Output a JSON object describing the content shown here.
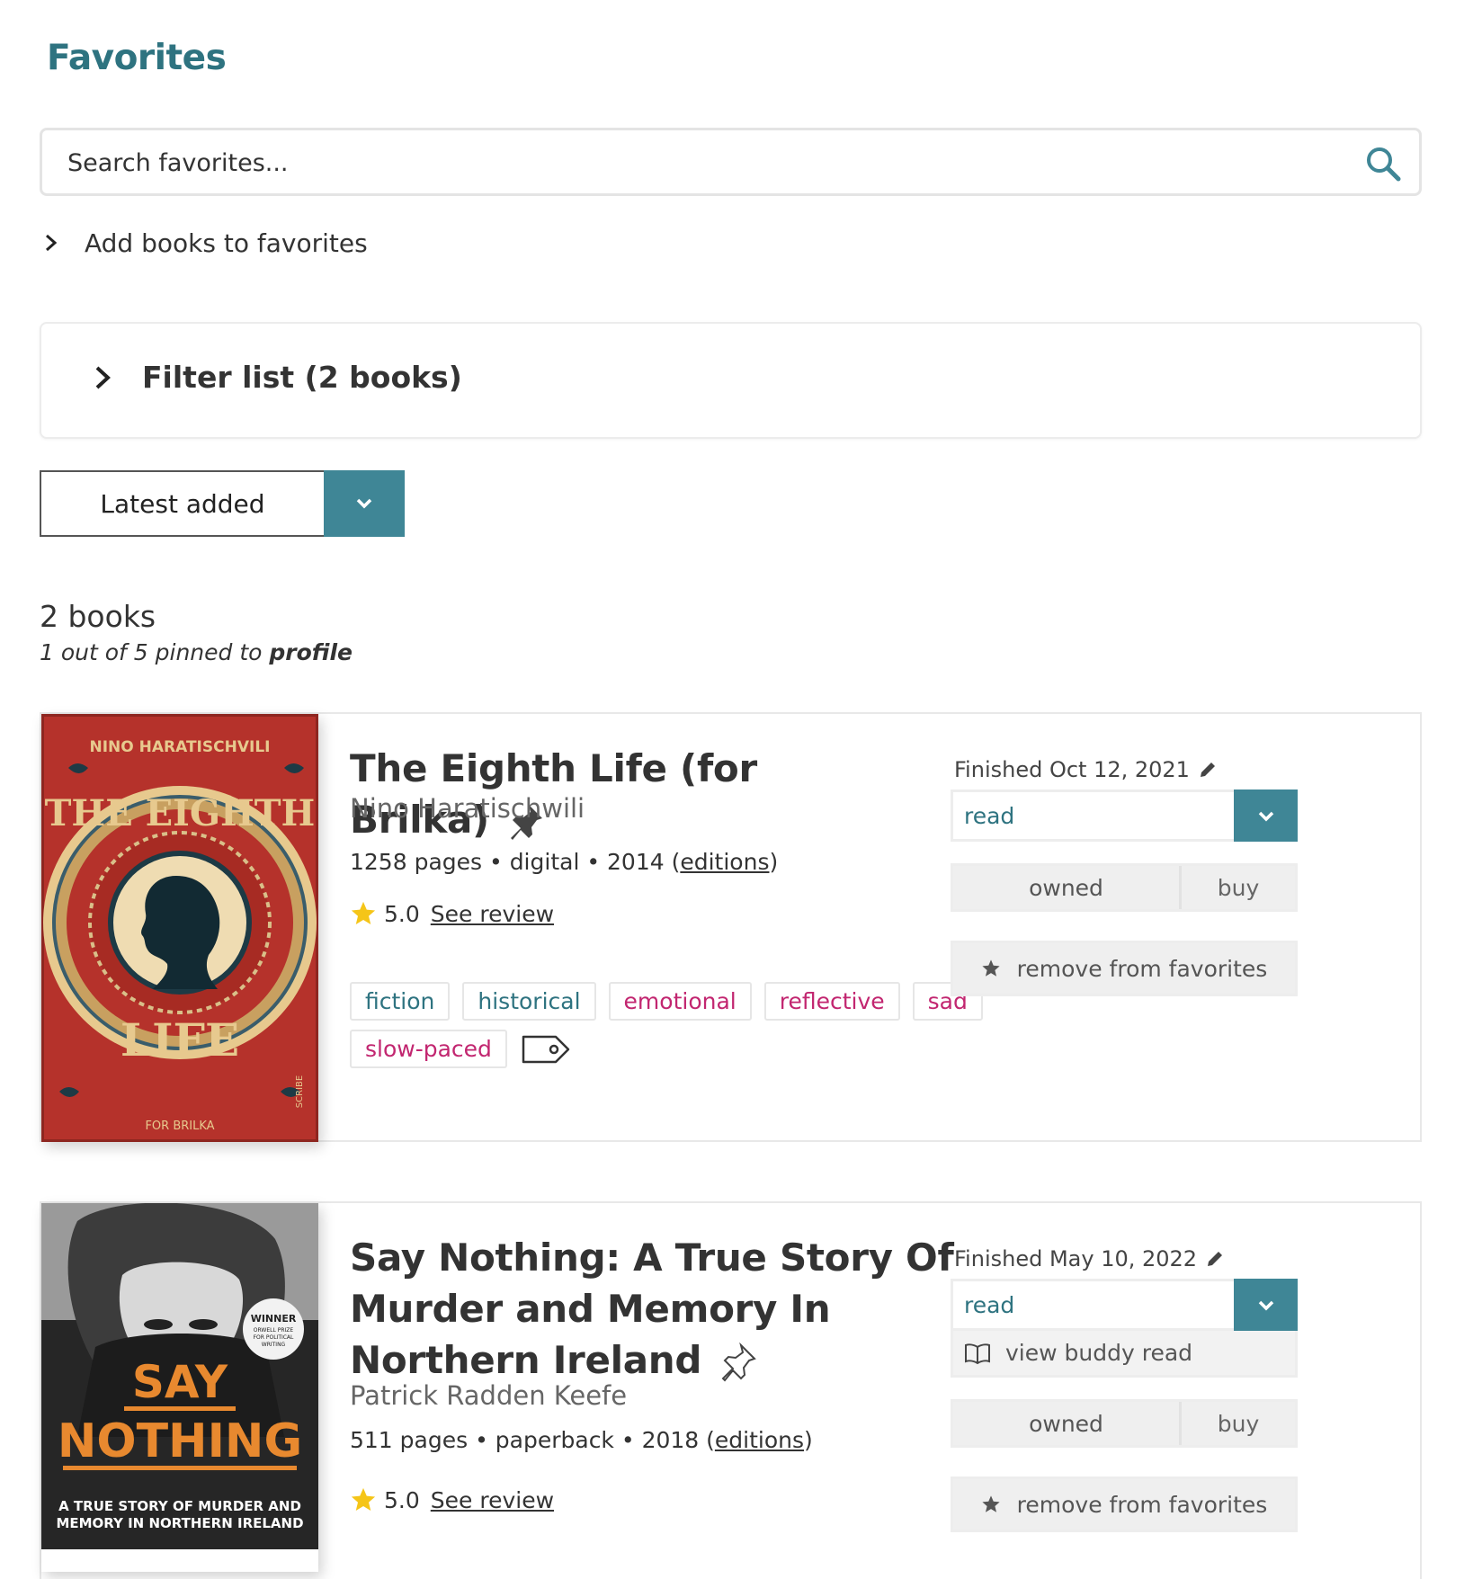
{
  "page": {
    "title": "Favorites",
    "search_placeholder": "Search favorites...",
    "add_books_label": "Add books to favorites",
    "filter_label": "Filter list (2 books)",
    "sort_value": "Latest added",
    "count_label": "2 books",
    "pinned_prefix": "1 out of 5 pinned to",
    "pinned_link": "profile"
  },
  "colors": {
    "accent": "#3f8696",
    "title_teal": "#2e7380",
    "mood_tag": "#c22670",
    "star_yellow": "#f5c518"
  },
  "books": [
    {
      "title": "The Eighth Life (for Brilka)",
      "pinned": true,
      "author": "Nino Haratischwili",
      "pages": "1258 pages",
      "format": "digital",
      "year": "2014",
      "editions_label": "editions",
      "rating": "5.0",
      "review_label": "See review",
      "tags_genre": [
        "fiction",
        "historical"
      ],
      "tags_mood": [
        "emotional",
        "reflective",
        "sad",
        "slow-paced"
      ],
      "finished": "Finished Oct 12, 2021",
      "status": "read",
      "owned_label": "owned",
      "buy_label": "buy",
      "remove_label": "remove from favorites",
      "cover": {
        "author_text": "NINO HARATISCHVILI",
        "title_top": "THE EIGHTH",
        "title_bottom": "LIFE",
        "subtitle": "FOR BRILKA",
        "publisher": "SCRIBE"
      }
    },
    {
      "title": "Say Nothing: A True Story Of Murder and Memory In Northern Ireland",
      "pinned": false,
      "author": "Patrick Radden Keefe",
      "pages": "511 pages",
      "format": "paperback",
      "year": "2018",
      "editions_label": "editions",
      "rating": "5.0",
      "review_label": "See review",
      "finished": "Finished May 10, 2022",
      "status": "read",
      "buddy_label": "view buddy read",
      "owned_label": "owned",
      "buy_label": "buy",
      "remove_label": "remove from favorites",
      "cover": {
        "badge_line1": "WINNER",
        "badge_line2": "ORWELL PRIZE",
        "badge_line3": "FOR POLITICAL",
        "badge_line4": "WRITING",
        "title_top": "SAY",
        "title_bottom": "NOTHING",
        "subtitle_line1": "A TRUE STORY OF MURDER AND",
        "subtitle_line2": "MEMORY IN NORTHERN IRELAND"
      }
    }
  ]
}
